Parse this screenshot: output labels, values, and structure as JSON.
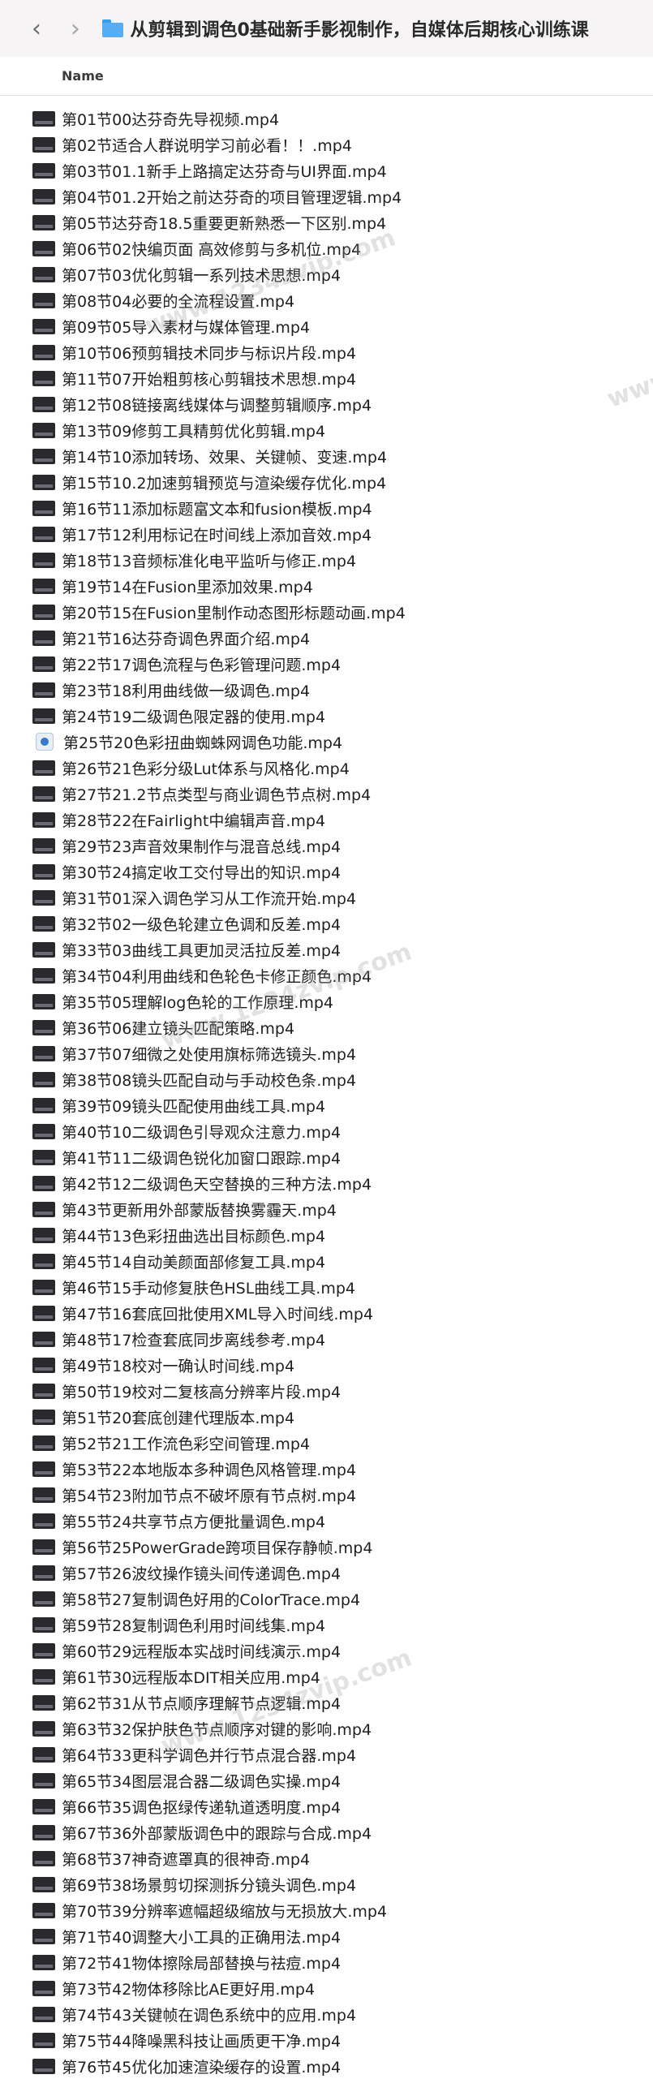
{
  "window": {
    "title": "从剪辑到调色0基础新手影视制作，自媒体后期核心训练课"
  },
  "nav": {
    "back_glyph": "‹",
    "forward_glyph": "›"
  },
  "columns": {
    "name": "Name"
  },
  "files": [
    "第01节00达芬奇先导视频.mp4",
    "第02节适合人群说明学习前必看！！.mp4",
    "第03节01.1新手上路搞定达芬奇与UI界面.mp4",
    "第04节01.2开始之前达芬奇的项目管理逻辑.mp4",
    "第05节达芬奇18.5重要更新熟悉一下区别.mp4",
    "第06节02快编页面 高效修剪与多机位.mp4",
    "第07节03优化剪辑一系列技术思想.mp4",
    "第08节04必要的全流程设置.mp4",
    "第09节05导入素材与媒体管理.mp4",
    "第10节06预剪辑技术同步与标识片段.mp4",
    "第11节07开始粗剪核心剪辑技术思想.mp4",
    "第12节08链接离线媒体与调整剪辑顺序.mp4",
    "第13节09修剪工具精剪优化剪辑.mp4",
    "第14节10添加转场、效果、关键帧、变速.mp4",
    "第15节10.2加速剪辑预览与渲染缓存优化.mp4",
    "第16节11添加标题富文本和fusion模板.mp4",
    "第17节12利用标记在时间线上添加音效.mp4",
    "第18节13音频标准化电平监听与修正.mp4",
    "第19节14在Fusion里添加效果.mp4",
    "第20节15在Fusion里制作动态图形标题动画.mp4",
    "第21节16达芬奇调色界面介绍.mp4",
    "第22节17调色流程与色彩管理问题.mp4",
    "第23节18利用曲线做一级调色.mp4",
    "第24节19二级调色限定器的使用.mp4",
    "第25节20色彩扭曲蜘蛛网调色功能.mp4",
    "第26节21色彩分级Lut体系与风格化.mp4",
    "第27节21.2节点类型与商业调色节点树.mp4",
    "第28节22在Fairlight中编辑声音.mp4",
    "第29节23声音效果制作与混音总线.mp4",
    "第30节24搞定收工交付导出的知识.mp4",
    "第31节01深入调色学习从工作流开始.mp4",
    "第32节02一级色轮建立色调和反差.mp4",
    "第33节03曲线工具更加灵活拉反差.mp4",
    "第34节04利用曲线和色轮色卡修正颜色.mp4",
    "第35节05理解log色轮的工作原理.mp4",
    "第36节06建立镜头匹配策略.mp4",
    "第37节07细微之处使用旗标筛选镜头.mp4",
    "第38节08镜头匹配自动与手动校色条.mp4",
    "第39节09镜头匹配使用曲线工具.mp4",
    "第40节10二级调色引导观众注意力.mp4",
    "第41节11二级调色锐化加窗口跟踪.mp4",
    "第42节12二级调色天空替换的三种方法.mp4",
    "第43节更新用外部蒙版替换雾霾天.mp4",
    "第44节13色彩扭曲选出目标颜色.mp4",
    "第45节14自动美颜面部修复工具.mp4",
    "第46节15手动修复肤色HSL曲线工具.mp4",
    "第47节16套底回批使用XML导入时间线.mp4",
    "第48节17检查套底同步离线参考.mp4",
    "第49节18校对一确认时间线.mp4",
    "第50节19校对二复核高分辨率片段.mp4",
    "第51节20套底创建代理版本.mp4",
    "第52节21工作流色彩空间管理.mp4",
    "第53节22本地版本多种调色风格管理.mp4",
    "第54节23附加节点不破坏原有节点树.mp4",
    "第55节24共享节点方便批量调色.mp4",
    "第56节25PowerGrade跨项目保存静帧.mp4",
    "第57节26波纹操作镜头间传递调色.mp4",
    "第58节27复制调色好用的ColorTrace.mp4",
    "第59节28复制调色利用时间线集.mp4",
    "第60节29远程版本实战时间线演示.mp4",
    "第61节30远程版本DIT相关应用.mp4",
    "第62节31从节点顺序理解节点逻辑.mp4",
    "第63节32保护肤色节点顺序对键的影响.mp4",
    "第64节33更科学调色并行节点混合器.mp4",
    "第65节34图层混合器二级调色实操.mp4",
    "第66节35调色抠绿传递轨道透明度.mp4",
    "第67节36外部蒙版调色中的跟踪与合成.mp4",
    "第68节37神奇遮罩真的很神奇.mp4",
    "第69节38场景剪切探测拆分镜头调色.mp4",
    "第70节39分辨率遮幅超级缩放与无损放大.mp4",
    "第71节40调整大小工具的正确用法.mp4",
    "第72节41物体擦除局部替换与祛痘.mp4",
    "第73节42物体移除比AE更好用.mp4",
    "第74节43关键帧在调色系统中的应用.mp4",
    "第75节44降噪黑科技让画质更干净.mp4",
    "第76节45优化加速渲染缓存的设置.mp4"
  ],
  "watermarks": [
    "www.1234zvip.com",
    "www.1234zvip.com",
    "www.1234zvip.com",
    "www.1234zvip.com"
  ],
  "colors": {
    "folder": "#57acf2",
    "toolbar_bg": "#f6f4f4"
  }
}
